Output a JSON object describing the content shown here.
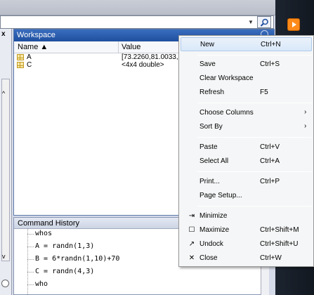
{
  "workspace": {
    "title": "Workspace",
    "col_name": "Name ▲",
    "col_value": "Value",
    "rows": [
      {
        "name": "A",
        "value": "[73.2260,81.0033,"
      },
      {
        "name": "C",
        "value": "<4x4 double>"
      }
    ]
  },
  "history": {
    "title": "Command History",
    "lines": [
      "whos",
      "A = randn(1,3)",
      "B = 6*randn(1,10)+70",
      "C = randn(4,3)",
      "who"
    ]
  },
  "left_panel": {
    "close": "x"
  },
  "context_menu": {
    "items": [
      {
        "label": "New",
        "shortcut": "Ctrl+N"
      },
      {
        "label": "Save",
        "shortcut": "Ctrl+S"
      },
      {
        "label": "Clear Workspace",
        "shortcut": ""
      },
      {
        "label": "Refresh",
        "shortcut": "F5"
      },
      {
        "label": "Choose Columns",
        "arrow": "›"
      },
      {
        "label": "Sort By",
        "arrow": "›"
      },
      {
        "label": "Paste",
        "shortcut": "Ctrl+V"
      },
      {
        "label": "Select All",
        "shortcut": "Ctrl+A"
      },
      {
        "label": "Print...",
        "shortcut": "Ctrl+P"
      },
      {
        "label": "Page Setup...",
        "shortcut": ""
      },
      {
        "label": "Minimize",
        "shortcut": "",
        "icon": "minimize-icon"
      },
      {
        "label": "Maximize",
        "shortcut": "Ctrl+Shift+M",
        "icon": "maximize-icon"
      },
      {
        "label": "Undock",
        "shortcut": "Ctrl+Shift+U",
        "icon": "undock-icon"
      },
      {
        "label": "Close",
        "shortcut": "Ctrl+W",
        "icon": "close-icon"
      }
    ]
  },
  "colors": {
    "titlebar": "#1f4f9f",
    "menu_hover": "#d9e8f8",
    "app_icon": "#ff8a1a"
  }
}
